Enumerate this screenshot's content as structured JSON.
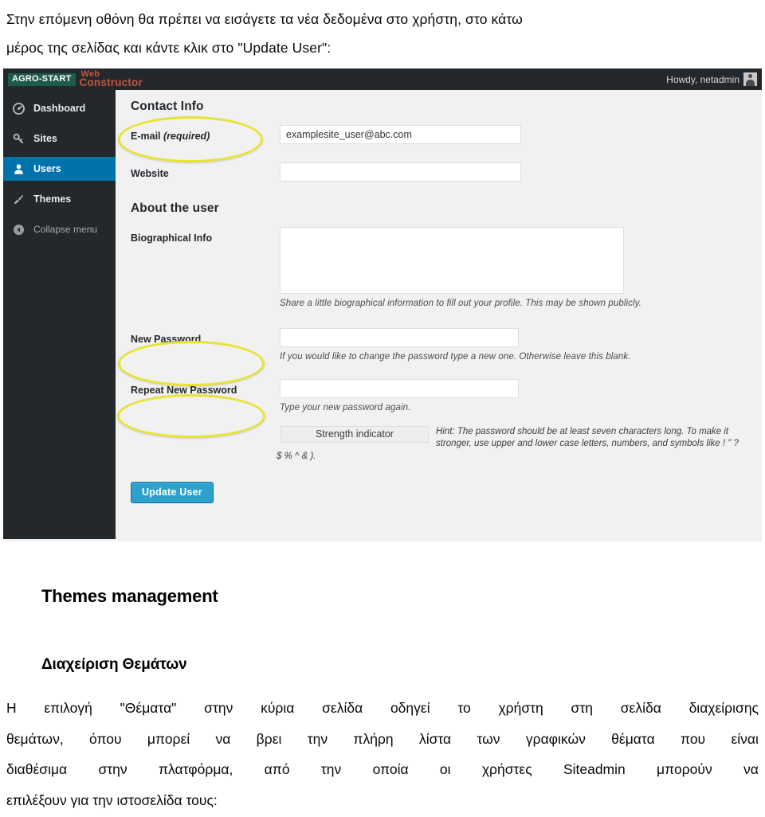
{
  "document": {
    "intro_lines": [
      "Στην επόμενη οθόνη θα πρέπει να εισάγετε τα νέα δεδομένα στο χρήστη, στο κάτω",
      "μέρος της σελίδας και κάντε κλικ στο \"Update User\":"
    ],
    "heading_en": "Themes management",
    "heading_gr": "Διαχείριση Θεμάτων",
    "paragraph_lines": [
      [
        "Η",
        "επιλογή",
        "\"Θέματα\"",
        "στην",
        "κύρια",
        "σελίδα",
        "οδηγεί",
        "το",
        "χρήστη",
        "στη",
        "σελίδα",
        "διαχείρισης"
      ],
      [
        "θεμάτων,",
        "όπου",
        "μπορεί",
        "να",
        "βρει",
        "την",
        "πλήρη",
        "λίστα",
        "των",
        "γραφικών",
        "θέματα",
        "που",
        "είναι"
      ],
      [
        "διαθέσιμα",
        "στην",
        "πλατφόρμα,",
        "από",
        "την",
        "οποία",
        "οι",
        "χρήστες",
        "Siteadmin",
        "μπορούν",
        "να"
      ],
      [
        "επιλέξουν για την ιστοσελίδα τους:"
      ]
    ]
  },
  "screenshot": {
    "adminbar": {
      "brand_badge": "AGRO-START",
      "brand_word1": "Web",
      "brand_word2": "Constructor",
      "howdy": "Howdy, netadmin"
    },
    "sidebar": {
      "items": [
        {
          "label": "Dashboard",
          "icon": "dashboard-gauge-icon",
          "active": false
        },
        {
          "label": "Sites",
          "icon": "key-icon",
          "active": false
        },
        {
          "label": "Users",
          "icon": "user-icon",
          "active": true
        },
        {
          "label": "Themes",
          "icon": "paintbrush-icon",
          "active": false
        }
      ],
      "collapse_label": "Collapse menu",
      "collapse_icon": "arrow-left-circle-icon"
    },
    "form": {
      "contact_section_title": "Contact Info",
      "email_label": "E-mail",
      "email_required_note": "(required)",
      "email_value": "examplesite_user@abc.com",
      "website_label": "Website",
      "website_value": "",
      "about_section_title": "About the user",
      "bio_label": "Biographical Info",
      "bio_value": "",
      "bio_helper": "Share a little biographical information to fill out your profile. This may be shown publicly.",
      "new_password_label": "New Password",
      "new_password_value": "",
      "new_password_helper": "If you would like to change the password type a new one. Otherwise leave this blank.",
      "repeat_password_label": "Repeat New Password",
      "repeat_password_value": "",
      "repeat_password_helper": "Type your new password again.",
      "strength_indicator_label": "Strength indicator",
      "password_hint": "Hint: The password should be at least seven characters long. To make it stronger, use upper and lower case letters, numbers, and symbols like ! \" ?",
      "password_hint_tail": "$ % ^ & ).",
      "submit_label": "Update User"
    },
    "colors": {
      "adminbar_bg": "#23282d",
      "sidebar_active": "#0073aa",
      "content_bg": "#f1f1f1",
      "primary_button": "#2ea2cc",
      "annotation": "#e8e335",
      "brand_badge_bg": "#1d5b4a",
      "brand_text": "#c0563b"
    },
    "annotations": [
      {
        "target": "email-label",
        "shape": "ellipse"
      },
      {
        "target": "new-password-label",
        "shape": "ellipse"
      },
      {
        "target": "repeat-new-password-label",
        "shape": "ellipse"
      }
    ]
  }
}
